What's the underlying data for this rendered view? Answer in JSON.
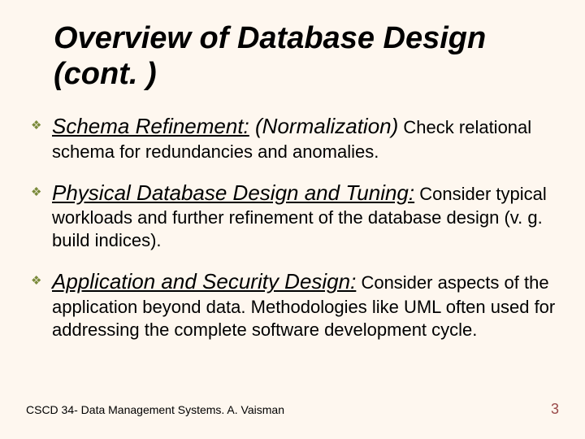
{
  "title": "Overview of Database Design (cont. )",
  "bullets": [
    {
      "lead": "Schema Refinement:",
      "paren": "  (Normalization)",
      "body_inline": "  Check relational ",
      "body_rest": "schema for redundancies and  anomalies."
    },
    {
      "lead": "Physical Database Design and Tuning:",
      "paren": "",
      "body_inline": "  Consider ",
      "body_rest": "typical workloads and further refinement of the database design (v. g. build indices)."
    },
    {
      "lead": "Application and Security Design:",
      "paren": "",
      "body_inline": " Consider aspects of the ",
      "body_rest": "application beyond data. Methodologies like UML often used for addressing the complete software development cycle."
    }
  ],
  "footer": {
    "left": "CSCD 34- Data Management Systems.  A. Vaisman",
    "right": "3"
  }
}
